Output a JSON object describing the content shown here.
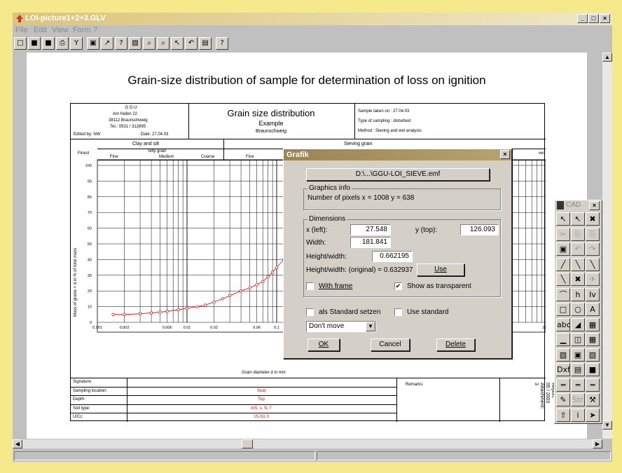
{
  "window": {
    "title": "LOI-picture1+2+3.GLV",
    "min": "_",
    "max": "□",
    "close": "×"
  },
  "menu": [
    "File",
    "Edit",
    "View",
    "Form",
    "?"
  ],
  "toolbar": [
    "□",
    "■",
    "■",
    "⎙",
    "Y",
    "▣",
    "↗",
    "?",
    "▧",
    "⌕",
    "⌕",
    "↖",
    "↶",
    "▤",
    "?"
  ],
  "page": {
    "title": "Grain-size distribution of sample for determination of loss on ignition",
    "report": {
      "company": [
        "G G U",
        "Am Hafen 22",
        "38112 Braunschweig",
        "Tel.: 0531 / 312895"
      ],
      "edited_by": "Edited by: NW",
      "date": "Date: 27.04.03",
      "heading": "Grain size distribution",
      "subheading": "Example",
      "location": "Braunschweig",
      "sample_taken": "Sample taken on : 27.04.03",
      "sampling_type": "Type of sampling : disturbed",
      "method": "Method : Sieving and wet analysis",
      "clay_silt": "Clay and silt",
      "sieving": "Sieving grain",
      "finest": "Finest",
      "silty_grain": "Silty grain",
      "fine": "Fine",
      "medium": "Medium",
      "coarse": "Coarse",
      "fine2": "Fine",
      "coarse2": "ves",
      "ylabel": "Mass of grains < d in % of total mass",
      "xlabel": "Grain diameter d in mm",
      "yticks": [
        "100",
        "90",
        "80",
        "70",
        "60",
        "50",
        "40",
        "30",
        "20",
        "10",
        "0"
      ],
      "xticks": [
        "0.001",
        "0.002",
        "0.006",
        "0.01",
        "0.02",
        "0.06",
        "0.1",
        "100"
      ],
      "footer": [
        {
          "label": "Signature:",
          "value": ""
        },
        {
          "label": "Sampling location:",
          "value": "Seal"
        },
        {
          "label": "Depth:",
          "value": "Top"
        },
        {
          "label": "Soil type:",
          "value": "mS, u, fs, t'"
        },
        {
          "label": "U/Cc:",
          "value": "15.0/2.3"
        }
      ],
      "remarks": "Remarks:",
      "report_info": "Report:\n05 / 2003\nAttachment:\n3"
    }
  },
  "chart_data": {
    "type": "line",
    "x": [
      0.0015,
      0.002,
      0.003,
      0.004,
      0.005,
      0.006,
      0.008,
      0.01,
      0.013,
      0.016,
      0.02,
      0.025,
      0.03,
      0.04,
      0.05,
      0.06,
      0.07,
      0.08,
      0.09,
      0.1,
      0.12,
      0.14
    ],
    "y": [
      5,
      5,
      5.5,
      6,
      6.5,
      7,
      8,
      9,
      10,
      11,
      13,
      15,
      17,
      20,
      22,
      24,
      26,
      29,
      32,
      35,
      40,
      44
    ],
    "xlabel": "Grain diameter d in mm",
    "ylabel": "Mass of grains < d in % of total mass",
    "ylim": [
      0,
      100
    ],
    "xscale": "log",
    "series": [
      {
        "name": "",
        "color": "#e00000"
      }
    ]
  },
  "dialog": {
    "title": "Grafik",
    "close": "×",
    "file_button": "D:\\...\\GGU-LOI_SIEVE.emf",
    "graphics_info": "Graphics info",
    "pixels": "Number of pixels x = 1008  y = 638",
    "dimensions": "Dimensions",
    "x_label": "x (left):",
    "x_value": "27.548",
    "y_label": "y (top):",
    "y_value": "126.093",
    "width_label": "Width:",
    "width_value": "181.841",
    "hw_label": "Height/width:",
    "hw_value": "0.662195",
    "hw_orig": "Height/width: (original) = 0.632937",
    "use": "Use",
    "with_frame": "With frame",
    "transparent": "Show as transparent",
    "transparent_checked": "✔",
    "als_standard": "als Standard setzen",
    "use_standard": "Use standard",
    "move_select": "Don't move",
    "ok": "OK",
    "cancel": "Cancel",
    "delete": "Delete"
  },
  "cad": {
    "title": "CAD",
    "close": "×",
    "tools": [
      "↖",
      "↖",
      "✖",
      "✂",
      "⎘",
      "⎘",
      "▣",
      "↶",
      "↷",
      "╱",
      "╲",
      "╲",
      "╲",
      "✖",
      "✈",
      "⌒",
      "h",
      "Iv",
      "□",
      "○",
      "A",
      "abc",
      "◢",
      "▦",
      "▁",
      "◫",
      "▦",
      "▧",
      "▣",
      "▧",
      "Dxf",
      "▤",
      "■",
      "═",
      "═",
      "═",
      "✎",
      "Str",
      "⚒",
      "⇧",
      "i",
      "➤"
    ]
  }
}
